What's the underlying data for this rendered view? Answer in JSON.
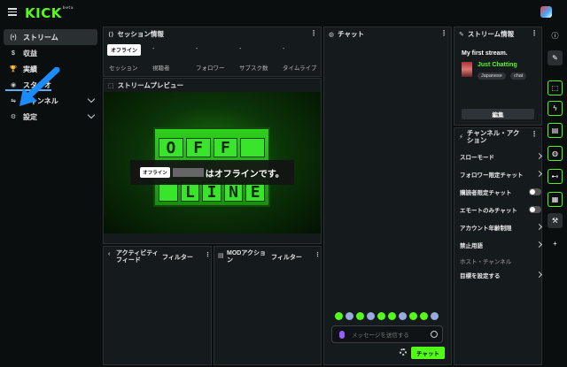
{
  "app": {
    "logo": "KICK",
    "logo_sup": "beta"
  },
  "sidebar": {
    "items": [
      {
        "icon": "(•)",
        "label": "ストリーム"
      },
      {
        "icon": "$",
        "label": "収益"
      },
      {
        "icon": "🏆",
        "label": "実績"
      },
      {
        "icon": "◉",
        "label": "スタジオ"
      },
      {
        "icon": "⇋",
        "label": "チャンネル"
      },
      {
        "icon": "⚙",
        "label": "設定"
      }
    ]
  },
  "session": {
    "title": "セッション情報",
    "stats": [
      {
        "value": "オフライン",
        "label": "セッション"
      },
      {
        "value": "-",
        "label": "視聴者"
      },
      {
        "value": "-",
        "label": "フォロワー"
      },
      {
        "value": "-",
        "label": "サブスク数"
      },
      {
        "value": "-",
        "label": "タイムライブ"
      }
    ]
  },
  "preview": {
    "title": "ストリームプレビュー",
    "board_top": [
      "O",
      "F",
      "F",
      ""
    ],
    "board_bottom": [
      "",
      "L",
      "I",
      "N",
      "E"
    ],
    "overlay_badge": "オフライン",
    "overlay_message": "はオフラインです。"
  },
  "activity": {
    "title": "アクティビティフィード",
    "filter": "フィルター"
  },
  "mod": {
    "title": "MODアクション",
    "filter": "フィルター"
  },
  "chat": {
    "title": "チャット",
    "placeholder": "メッセージを送信する",
    "send_label": "チャット"
  },
  "stream_info": {
    "title": "ストリーム情報",
    "stream_title": "My first stream.",
    "category": "Just Chatting",
    "tags": [
      "Japanese",
      "chat"
    ],
    "edit_label": "編集"
  },
  "channel_actions": {
    "title": "チャンネル・アクション",
    "items": [
      {
        "label": "スローモード",
        "control": "arrow"
      },
      {
        "label": "フォロワー限定チャット",
        "control": "arrow"
      },
      {
        "label": "購読者限定チャット",
        "control": "toggle"
      },
      {
        "label": "エモートのみチャット",
        "control": "toggle"
      },
      {
        "label": "アカウント年齢制限",
        "control": "arrow"
      },
      {
        "label": "禁止用語",
        "control": "arrow"
      },
      {
        "label": "ホスト・チャンネル",
        "control": "none"
      },
      {
        "label": "目標を設定する",
        "control": "arrow"
      }
    ]
  },
  "colors": {
    "accent": "#53fc18",
    "panel": "#151a1c",
    "background": "#0b0e0f",
    "highlight": "#5ab0ff"
  }
}
